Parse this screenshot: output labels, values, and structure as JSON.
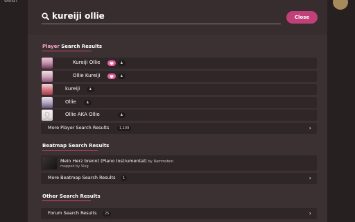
{
  "search": {
    "query": "kureiji ollie",
    "close_label": "Close"
  },
  "player_section": {
    "title_hl": "Player",
    "title_rest": " Search Results",
    "players": [
      {
        "name": "Kureiji Ollie",
        "flags": [
          "nz",
          "sg"
        ],
        "heart": true
      },
      {
        "name": "Ollie Kureiji",
        "flags": [
          "ru",
          "my"
        ],
        "heart": true
      },
      {
        "name": "kureiji",
        "flags": [
          "ir"
        ],
        "heart": false
      },
      {
        "name": "Ollie",
        "flags": [
          "gb"
        ],
        "heart": false
      },
      {
        "name": "Ollie AKA Ollie",
        "flags": [
          "unknown"
        ],
        "heart": false
      }
    ],
    "more_label": "More Player Search Results",
    "more_count": "1,109"
  },
  "beatmap_section": {
    "title": "Beatmap Search Results",
    "beatmap": {
      "title": "Mein Herz brennt (Piano Instrumental)",
      "by": "by",
      "artist": "Rammstein",
      "mapper": "mapped by Sieg"
    },
    "more_label": "More Beatmap Search Results",
    "more_count": "1"
  },
  "other_section": {
    "title": "Other Search Results",
    "forum_label": "Forum Search Results",
    "forum_count": "25"
  },
  "colors": {
    "accent": "#d6477f",
    "panel": "#3b3132",
    "row": "#2f2627",
    "close": "#c2407a"
  }
}
